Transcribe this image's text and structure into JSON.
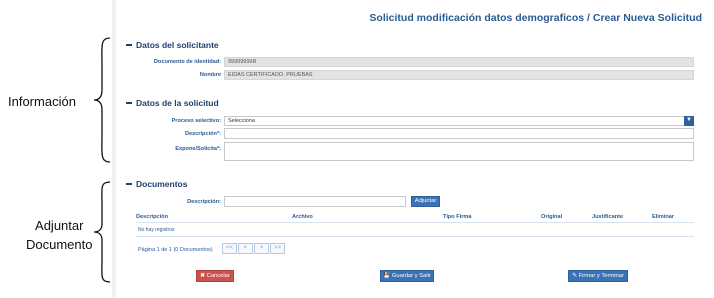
{
  "annotations": {
    "informacion": "Información",
    "adjuntar_line1": "Adjuntar",
    "adjuntar_line2": "Documento"
  },
  "page": {
    "title": "Solicitud modificación datos demograficos / Crear Nueva Solicitud"
  },
  "solicitante": {
    "heading": "Datos del solicitante",
    "doc_label": "Documento de identidad:",
    "doc_value": "99999999R",
    "name_label": "Nombre",
    "name_value": "EIDAS CERTIFICADO, PRUEBAS"
  },
  "solicitud": {
    "heading": "Datos de la solicitud",
    "proceso_label": "Proceso selectivo:",
    "proceso_value": "Selecciona",
    "descripcion_label": "Descripción*:",
    "expone_label": "Expone/Solicita*:"
  },
  "documentos": {
    "heading": "Documentos",
    "descripcion_label": "Descripción:",
    "adjuntar_button": "Adjuntar",
    "columns": [
      "Descripción",
      "Archivo",
      "Tipo Firma",
      "Original",
      "Justificante",
      "Eliminar"
    ],
    "empty_text": "No hay registros",
    "pager_text": "Página 1 de 1 (0 Documentos)",
    "pager_buttons": [
      "<<",
      "<",
      ">",
      ">>"
    ]
  },
  "actions": {
    "cancel": "Cancelar",
    "save": "Guardar y Salir",
    "sign": "Firmar y Terminar"
  },
  "colors": {
    "title": "#2b5a93",
    "accent": "#3b72b5",
    "cancel": "#c9534f"
  }
}
